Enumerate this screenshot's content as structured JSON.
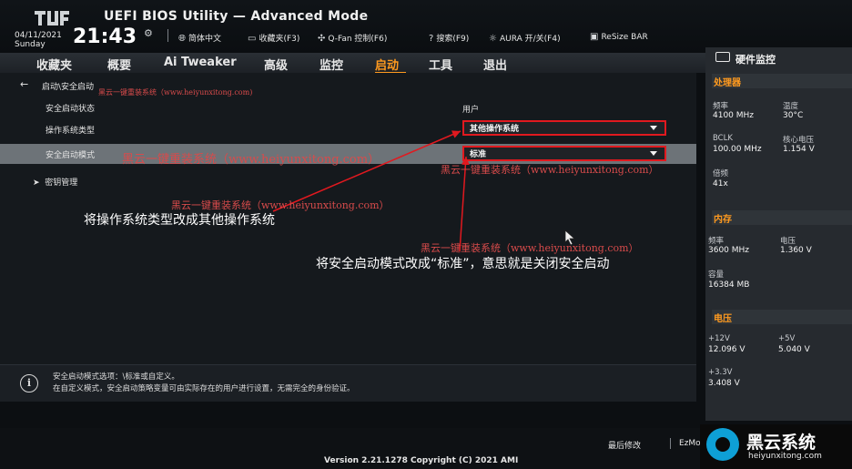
{
  "header": {
    "title": "UEFI BIOS Utility — Advanced Mode",
    "date": "04/11/2021",
    "day": "Sunday",
    "time": "21:43",
    "tools": [
      {
        "icon": "globe-icon",
        "label": "简体中文"
      },
      {
        "icon": "bookmark-icon",
        "label": "收藏夹(F3)"
      },
      {
        "icon": "fan-icon",
        "label": "Q-Fan 控制(F6)"
      },
      {
        "icon": "help-search-icon",
        "label": "搜索(F9)"
      },
      {
        "icon": "aura-icon",
        "label": "AURA 开/关(F4)"
      },
      {
        "icon": "resize-bar-icon",
        "label": "ReSize BAR"
      }
    ]
  },
  "menu": [
    "收藏夹",
    "概要",
    "Ai Tweaker",
    "高级",
    "监控",
    "启动",
    "工具",
    "退出"
  ],
  "menu_active": "启动",
  "main": {
    "breadcrumb": "启动\\安全启动",
    "secure_boot_state_label": "安全启动状态",
    "secure_boot_state_value": "用户",
    "os_type_label": "操作系统类型",
    "os_type_value": "其他操作系统",
    "secure_boot_mode_label": "安全启动模式",
    "secure_boot_mode_value": "标准",
    "key_management_label": "密钥管理"
  },
  "annotations": {
    "note1": "将操作系统类型改成其他操作系统",
    "note2": "将安全启动模式改成“标准”，意思就是关闭安全启动"
  },
  "watermarks": {
    "w1": "黑云一键重装系统（www.heiyunxitong.com)",
    "w2": "黑云一键重装系统（www.heiyunxitong.com）",
    "w3": "黑云一键重装系统（www.heiyunxitong.com）",
    "w4": "黑云一键重装系统（www.heiyunxitong.com）",
    "w5": "黑云一键重装系统（www.heiyunxitong.com）"
  },
  "help": {
    "line1": "安全启动模式选项：\\标准或自定义。",
    "line2": "在自定义模式，安全启动策略变量可由实际存在的用户进行设置，无需完全的身份验证。"
  },
  "footer": {
    "version": "Version 2.21.1278 Copyright (C) 2021 AMI",
    "last_modified": "最后修改",
    "ez_mode": "EzMode(F7)",
    "brand_name": "黑云系统",
    "brand_url": "heiyunxitong.com"
  },
  "hw_monitor": {
    "title": "硬件监控",
    "cpu": {
      "section": "处理器",
      "freq_label": "频率",
      "freq": "4100 MHz",
      "temp_label": "温度",
      "temp": "30°C",
      "bclk_label": "BCLK",
      "bclk": "100.00 MHz",
      "vcore_label": "核心电压",
      "vcore": "1.154 V",
      "ratio_label": "倍频",
      "ratio": "41x"
    },
    "memory": {
      "section": "内存",
      "freq_label": "频率",
      "freq": "3600 MHz",
      "volt_label": "电压",
      "volt": "1.360 V",
      "cap_label": "容量",
      "cap": "16384 MB"
    },
    "voltage": {
      "section": "电压",
      "p12_label": "+12V",
      "p12": "12.096 V",
      "p5_label": "+5V",
      "p5": "5.040 V",
      "p33_label": "+3.3V",
      "p33": "3.408 V"
    }
  },
  "colors": {
    "accent": "#ff9a1f",
    "annotation_red": "#e1191f",
    "brand_blue": "#0ea0d6"
  }
}
